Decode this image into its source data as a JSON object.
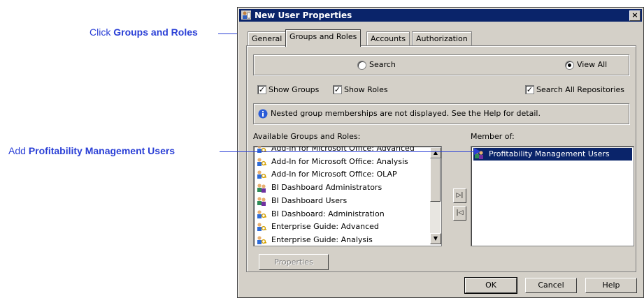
{
  "callouts": {
    "groups": {
      "prefix": "Click ",
      "bold": "Groups and Roles"
    },
    "add": {
      "prefix": "Add ",
      "bold": "Profitability Management Users"
    }
  },
  "dialog": {
    "title": "New User Properties",
    "close_glyph": "×",
    "tabs": [
      "General",
      "Groups and Roles",
      "Accounts",
      "Authorization"
    ],
    "active_tab": "Groups and Roles",
    "mode": {
      "search_label": "Search",
      "viewall_label": "View All",
      "selected": "View All"
    },
    "filters": {
      "show_groups_label": "Show Groups",
      "show_groups_checked": true,
      "show_roles_label": "Show Roles",
      "show_roles_checked": true,
      "search_all_label": "Search All Repositories",
      "search_all_checked": true,
      "check_glyph": "✓"
    },
    "info_text": "Nested group memberships are not displayed. See the Help for detail.",
    "available": {
      "label": "Available Groups and Roles:",
      "items": [
        "Add-In for Microsoft Office: Advanced",
        "Add-In for Microsoft Office: Analysis",
        "Add-In for Microsoft Office: OLAP",
        "BI Dashboard Administrators",
        "BI Dashboard Users",
        "BI Dashboard: Administration",
        "Enterprise Guide: Advanced",
        "Enterprise Guide: Analysis"
      ],
      "item_icons": [
        "role-icon",
        "role-icon",
        "role-icon",
        "group-icon",
        "group-icon",
        "role-icon",
        "role-icon",
        "role-icon"
      ]
    },
    "member_of": {
      "label": "Member of:",
      "items": [
        "Profitability Management Users"
      ],
      "selected_index": 0
    },
    "move_right_glyph": "▷|",
    "move_left_glyph": "|◁",
    "properties_label": "Properties",
    "ok_label": "OK",
    "cancel_label": "Cancel",
    "help_label": "Help"
  },
  "colors": {
    "callout": "#2a3fd6",
    "titlebar": "#0a246a",
    "face": "#d4d0c8",
    "selection": "#0a246a"
  }
}
